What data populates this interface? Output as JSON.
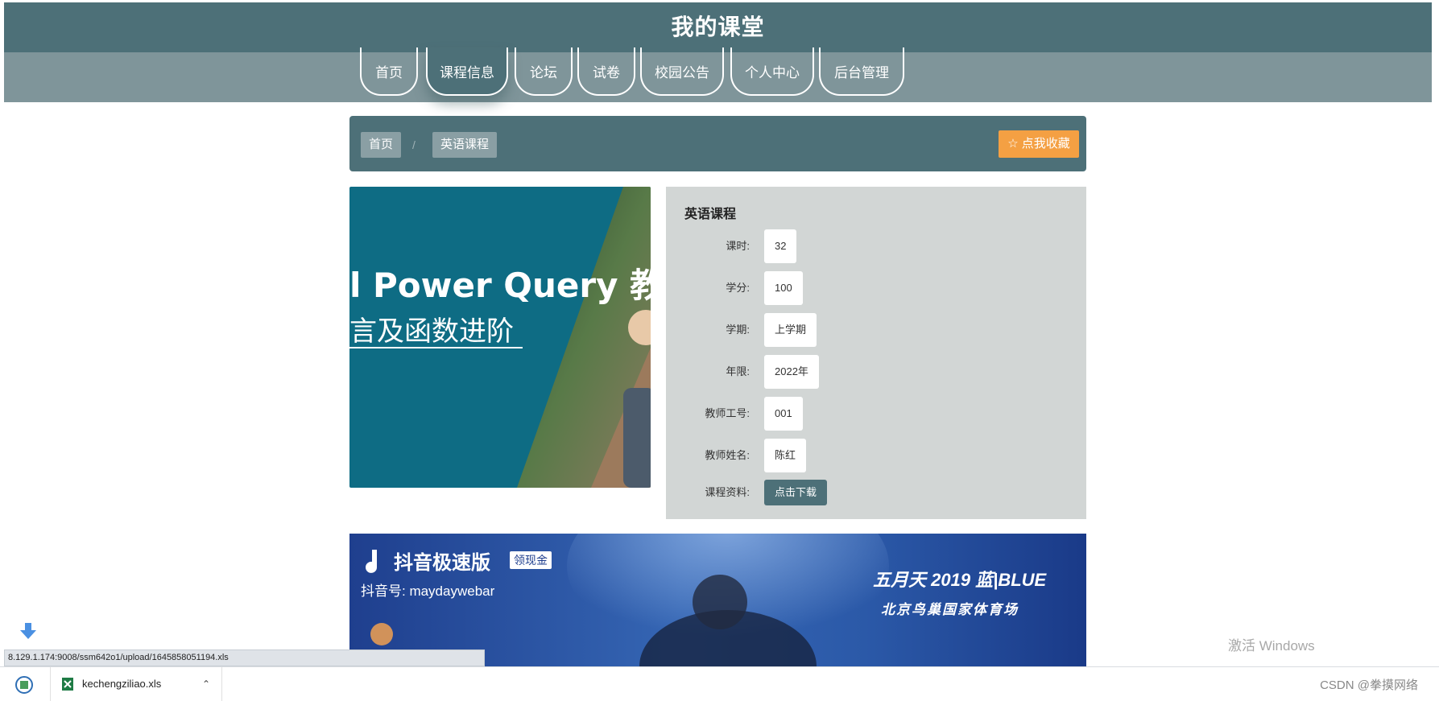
{
  "header": {
    "title": "我的课堂"
  },
  "nav": {
    "items": [
      {
        "label": "首页"
      },
      {
        "label": "课程信息",
        "active": true
      },
      {
        "label": "论坛"
      },
      {
        "label": "试卷"
      },
      {
        "label": "校园公告"
      },
      {
        "label": "个人中心"
      },
      {
        "label": "后台管理"
      }
    ]
  },
  "breadcrumb": {
    "home": "首页",
    "separator": "/",
    "current": "英语课程"
  },
  "favorite_button": {
    "icon": "star-outline-icon",
    "label": "☆ 点我收藏"
  },
  "course_image": {
    "line1": "l Power Query 教",
    "line2": "言及函数进阶"
  },
  "course": {
    "title": "英语课程",
    "fields": [
      {
        "label": "课时:",
        "value": "32"
      },
      {
        "label": "学分:",
        "value": "100"
      },
      {
        "label": "学期:",
        "value": "上学期"
      },
      {
        "label": "年限:",
        "value": "2022年"
      },
      {
        "label": "教师工号:",
        "value": "001"
      },
      {
        "label": "教师姓名:",
        "value": "陈红"
      }
    ],
    "material": {
      "label": "课程资料:",
      "button": "点击下载"
    }
  },
  "video": {
    "app_name": "抖音极速版",
    "badge": "领现金",
    "account": "抖音号: maydaywebar",
    "event_title": "五月天 2019 蓝|BLUE",
    "venue": "北京鸟巢国家体育场"
  },
  "status_bar": {
    "url": "8.129.1.174:9008/ssm642o1/upload/1645858051194.xls"
  },
  "downloads": {
    "file_name": "kechengziliao.xls"
  },
  "watermark": {
    "text": "CSDN @拳摸网络",
    "windows": "激活 Windows"
  },
  "colors": {
    "primary": "#4d7078",
    "nav": "#7f959a",
    "accent": "#f4a043",
    "panel": "#d2d6d5"
  }
}
